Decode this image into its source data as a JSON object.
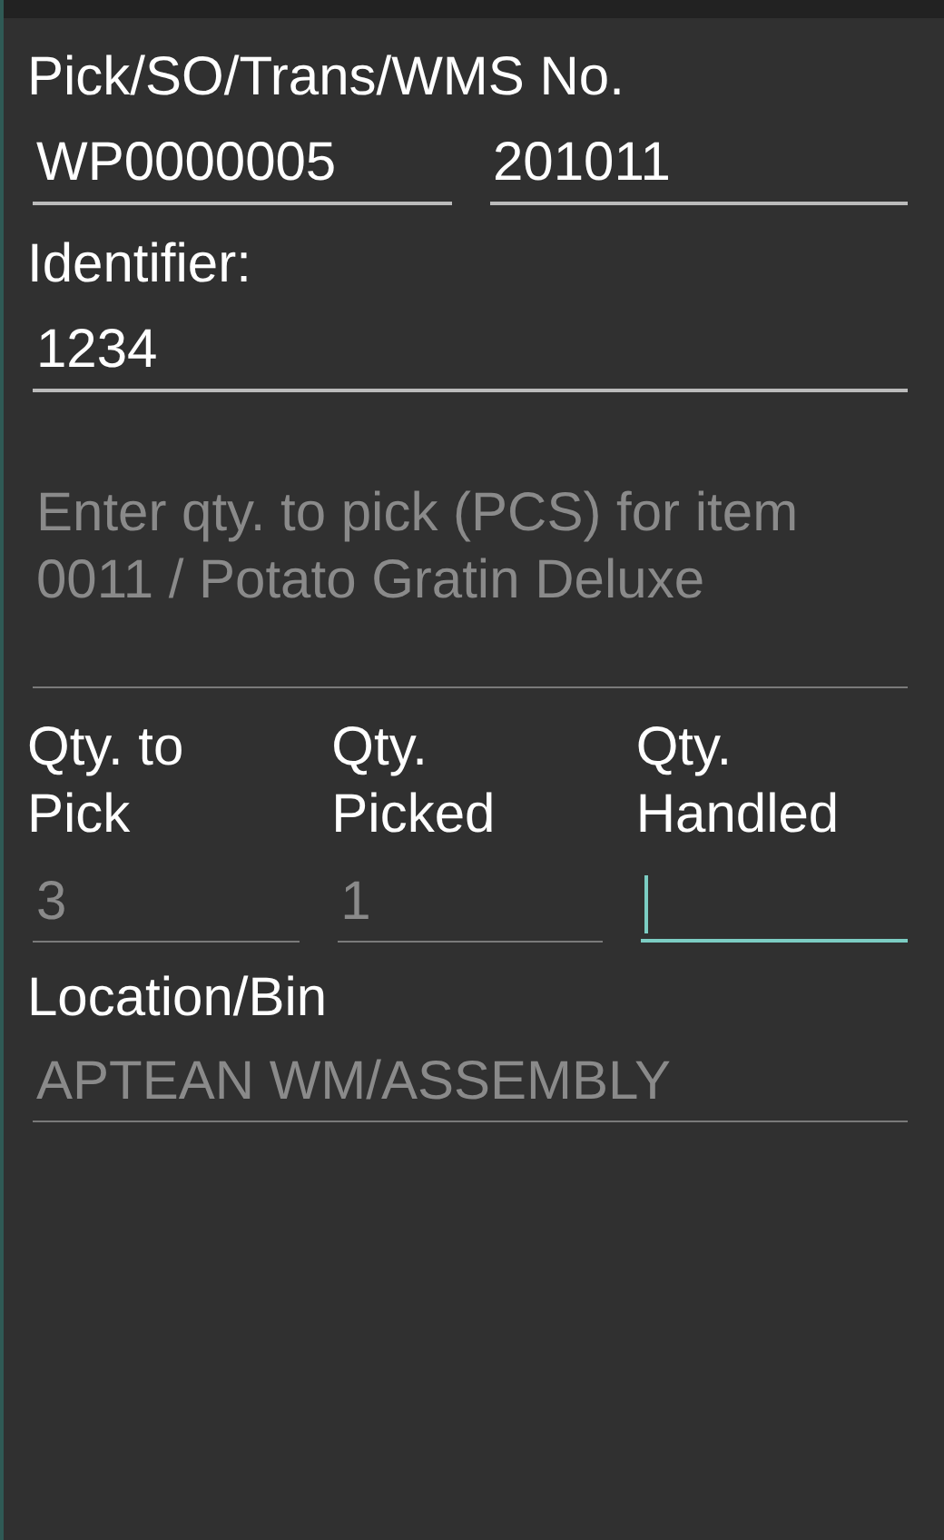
{
  "document_field": {
    "label": "Pick/SO/Trans/WMS No.",
    "values": [
      {
        "value": "WP0000005",
        "disabled": false,
        "focused": false
      },
      {
        "value": "201011",
        "disabled": false,
        "focused": false
      }
    ]
  },
  "identifier_field": {
    "label": "Identifier:",
    "value": "1234",
    "disabled": false,
    "focused": false
  },
  "prompt": {
    "text": "Enter qty. to pick (PCS) for item 0011 / Potato Gratin Deluxe",
    "disabled": true
  },
  "quantities": [
    {
      "label": "Qty. to Pick",
      "value": "3",
      "disabled": true,
      "focused": false
    },
    {
      "label": "Qty. Picked",
      "value": "1",
      "disabled": true,
      "focused": false
    },
    {
      "label": "Qty. Handled",
      "disabled": false,
      "focused": true
    }
  ],
  "location_field": {
    "label": "Location/Bin",
    "value": "APTEAN WM/ASSEMBLY",
    "disabled": true,
    "focused": false
  }
}
